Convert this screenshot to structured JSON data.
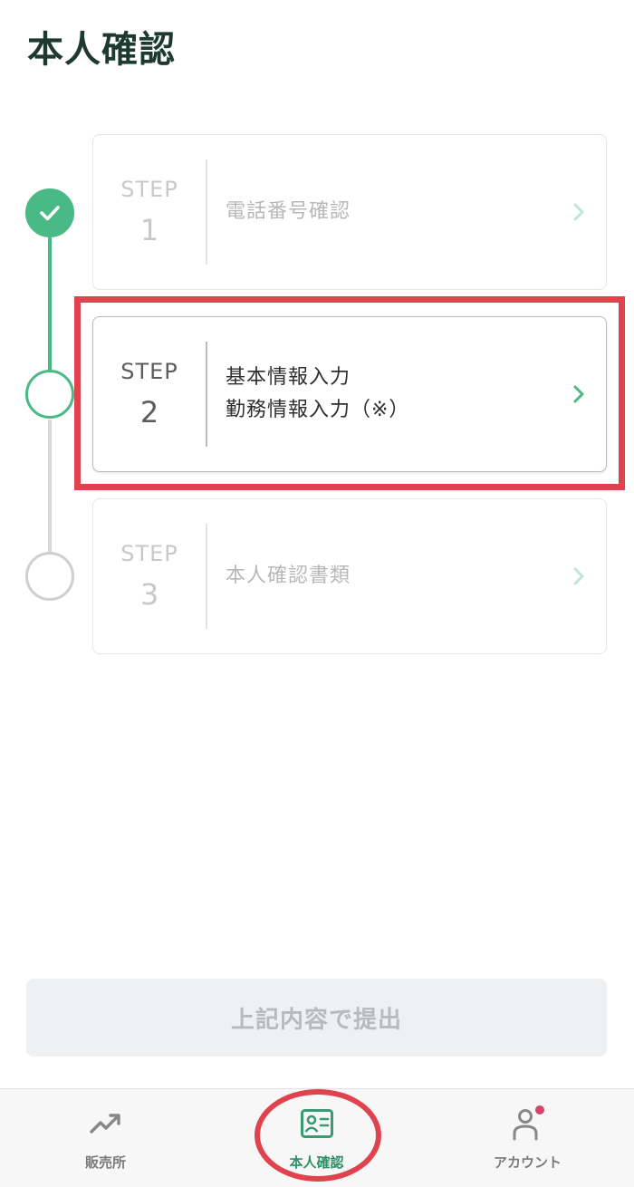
{
  "header": {
    "title": "本人確認"
  },
  "steps": [
    {
      "label": "STEP",
      "number": "1",
      "lines": [
        "電話番号確認"
      ],
      "state": "completed"
    },
    {
      "label": "STEP",
      "number": "2",
      "lines": [
        "基本情報入力",
        "勤務情報入力（※）"
      ],
      "state": "current"
    },
    {
      "label": "STEP",
      "number": "3",
      "lines": [
        "本人確認書類"
      ],
      "state": "pending"
    }
  ],
  "submit": {
    "label": "上記内容で提出",
    "enabled": false
  },
  "nav": {
    "items": [
      {
        "label": "販売所",
        "icon": "trend-up-icon"
      },
      {
        "label": "本人確認",
        "icon": "id-card-icon",
        "active": true
      },
      {
        "label": "アカウント",
        "icon": "user-icon",
        "badge": true
      }
    ]
  },
  "colors": {
    "accent": "#49b986",
    "annotation": "#e0424e",
    "title": "#1e3a30"
  }
}
